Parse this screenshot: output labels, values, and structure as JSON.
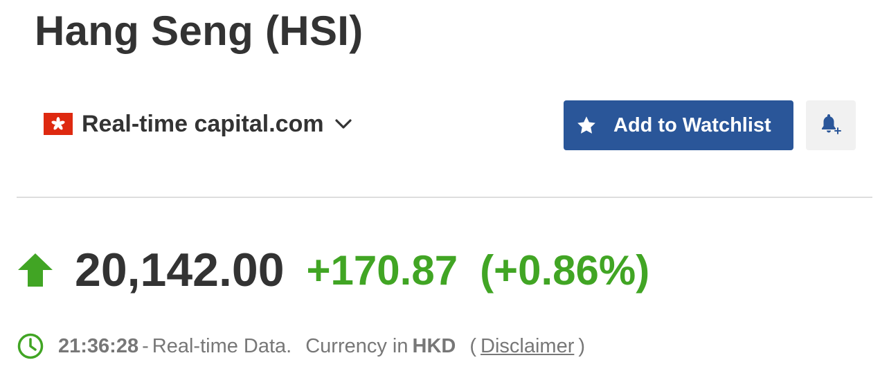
{
  "header": {
    "title": "Hang Seng (HSI)"
  },
  "source": {
    "label": "Real-time capital.com",
    "flag_color": "#de2910"
  },
  "actions": {
    "watchlist_label": "Add to Watchlist",
    "watchlist_icon": "star-icon",
    "alert_icon": "bell-plus-icon",
    "brand_color": "#2a5699"
  },
  "quote": {
    "direction_icon": "up-arrow-icon",
    "last": "20,142.00",
    "change": "+170.87",
    "change_pct": "(+0.86%)",
    "positive_color": "#41a524"
  },
  "info": {
    "time": "21:36:28",
    "separator": "-",
    "data_label": "Real-time Data.",
    "currency_label": "Currency in",
    "currency": "HKD",
    "open_paren": "(",
    "disclaimer": "Disclaimer",
    "close_paren": ")"
  }
}
